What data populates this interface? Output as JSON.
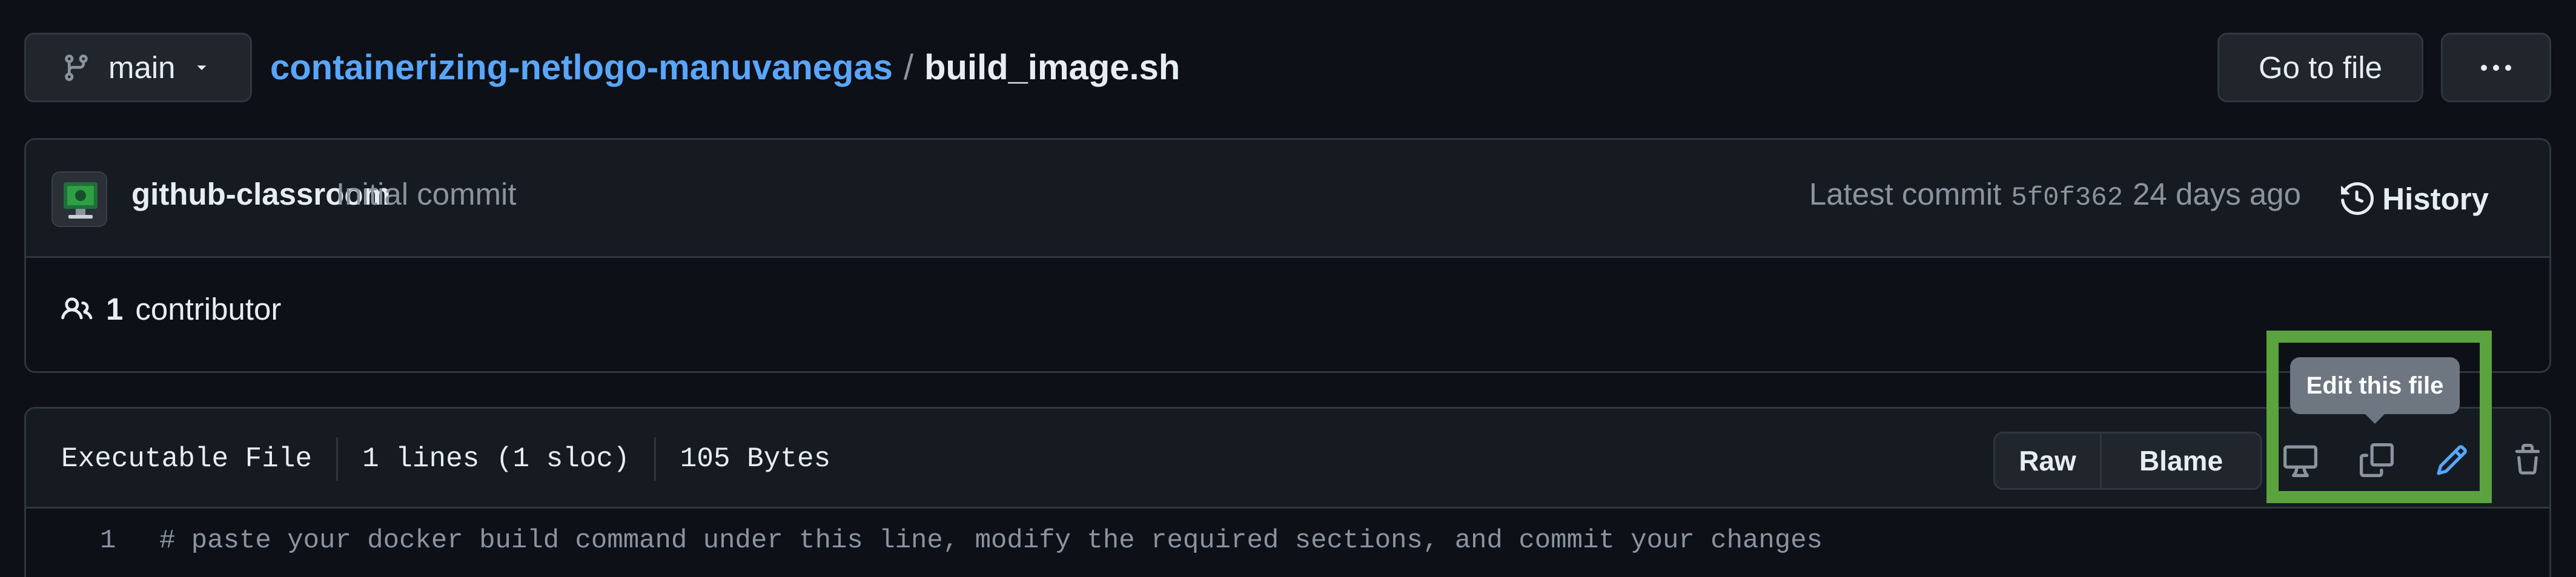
{
  "branch": {
    "name": "main",
    "icon": "git-branch-icon"
  },
  "breadcrumb": {
    "repo": "containerizing-netlogo-manuvanegas",
    "separator": "/",
    "file": "build_image.sh"
  },
  "toolbar": {
    "goto_file_label": "Go to file",
    "more_label": "···"
  },
  "commit": {
    "author": "github-classroom",
    "message": "Initial commit",
    "latest_label": "Latest commit",
    "sha": "5f0f362",
    "time": "24 days ago",
    "history_label": "History"
  },
  "contributors": {
    "count": "1",
    "label": "contributor"
  },
  "file": {
    "type": "Executable File",
    "lines": "1 lines (1 sloc)",
    "size": "105 Bytes",
    "raw_label": "Raw",
    "blame_label": "Blame",
    "tooltip": "Edit this file"
  },
  "code": {
    "lines": [
      {
        "number": "1",
        "text": "# paste your docker build command under this line, modify the required sections, and commit your changes"
      }
    ]
  },
  "colors": {
    "background": "#0d1117",
    "link": "#58a6ff",
    "highlight": "#5aa33f",
    "tooltip": "#6e7681"
  }
}
